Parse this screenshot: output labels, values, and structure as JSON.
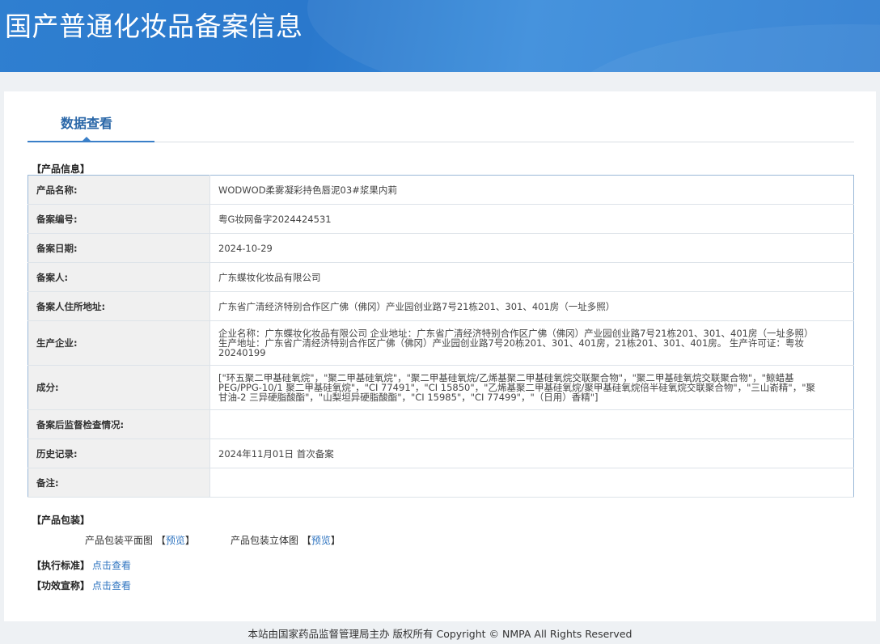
{
  "header": {
    "title": "国产普通化妆品备案信息"
  },
  "tabs": [
    {
      "label": "数据查看"
    }
  ],
  "product_info": {
    "section_title": "【产品信息】",
    "rows": [
      {
        "label": "产品名称:",
        "value": "WODWOD柔雾凝彩持色唇泥03#浆果内莉"
      },
      {
        "label": "备案编号:",
        "value": "粤G妆网备字2024424531"
      },
      {
        "label": "备案日期:",
        "value": "2024-10-29"
      },
      {
        "label": "备案人:",
        "value": "广东蝶妆化妆品有限公司"
      },
      {
        "label": "备案人住所地址:",
        "value": "广东省广清经济特别合作区广佛（佛冈）产业园创业路7号21栋201、301、401房（一址多照）"
      },
      {
        "label": "生产企业:",
        "value": "企业名称：广东蝶妆化妆品有限公司 企业地址：广东省广清经济特别合作区广佛（佛冈）产业园创业路7号21栋201、301、401房（一址多照） 生产地址：广东省广清经济特别合作区广佛（佛冈）产业园创业路7号20栋201、301、401房，21栋201、301、401房。 生产许可证：粤妆20240199"
      },
      {
        "label": "成分:",
        "value": "[\"环五聚二甲基硅氧烷\"，\"聚二甲基硅氧烷\"，\"聚二甲基硅氧烷/乙烯基聚二甲基硅氧烷交联聚合物\"，\"聚二甲基硅氧烷交联聚合物\"，\"鲸蜡基 PEG/PPG-10/1 聚二甲基硅氧烷\"，\"CI 77491\"，\"CI 15850\"，\"乙烯基聚二甲基硅氧烷/聚甲基硅氧烷倍半硅氧烷交联聚合物\"，\"三山嵛精\"，\"聚甘油-2 三异硬脂酸酯\"，\"山梨坦异硬脂酸酯\"，\"CI 15985\"，\"CI 77499\"，\"（日用）香精\"]"
      },
      {
        "label": "备案后监督检查情况:",
        "value": ""
      },
      {
        "label": "历史记录:",
        "value": "2024年11月01日 首次备案"
      },
      {
        "label": "备注:",
        "value": ""
      }
    ]
  },
  "packaging": {
    "section_title": "【产品包装】",
    "flat_label": "产品包装平面图",
    "stereo_label": "产品包装立体图",
    "bracket_open": "【",
    "bracket_close": "】",
    "preview_label": "预览"
  },
  "standard": {
    "section_title": "【执行标准】",
    "link_label": "点击查看"
  },
  "efficacy": {
    "section_title": "【功效宣称】",
    "link_label": "点击查看"
  },
  "footer": {
    "text": "本站由国家药品监督管理局主办 版权所有 Copyright © NMPA All Rights Reserved"
  },
  "colors": {
    "banner": "#2f7fd0",
    "accent": "#2a67a8",
    "link": "#2f74c0"
  }
}
